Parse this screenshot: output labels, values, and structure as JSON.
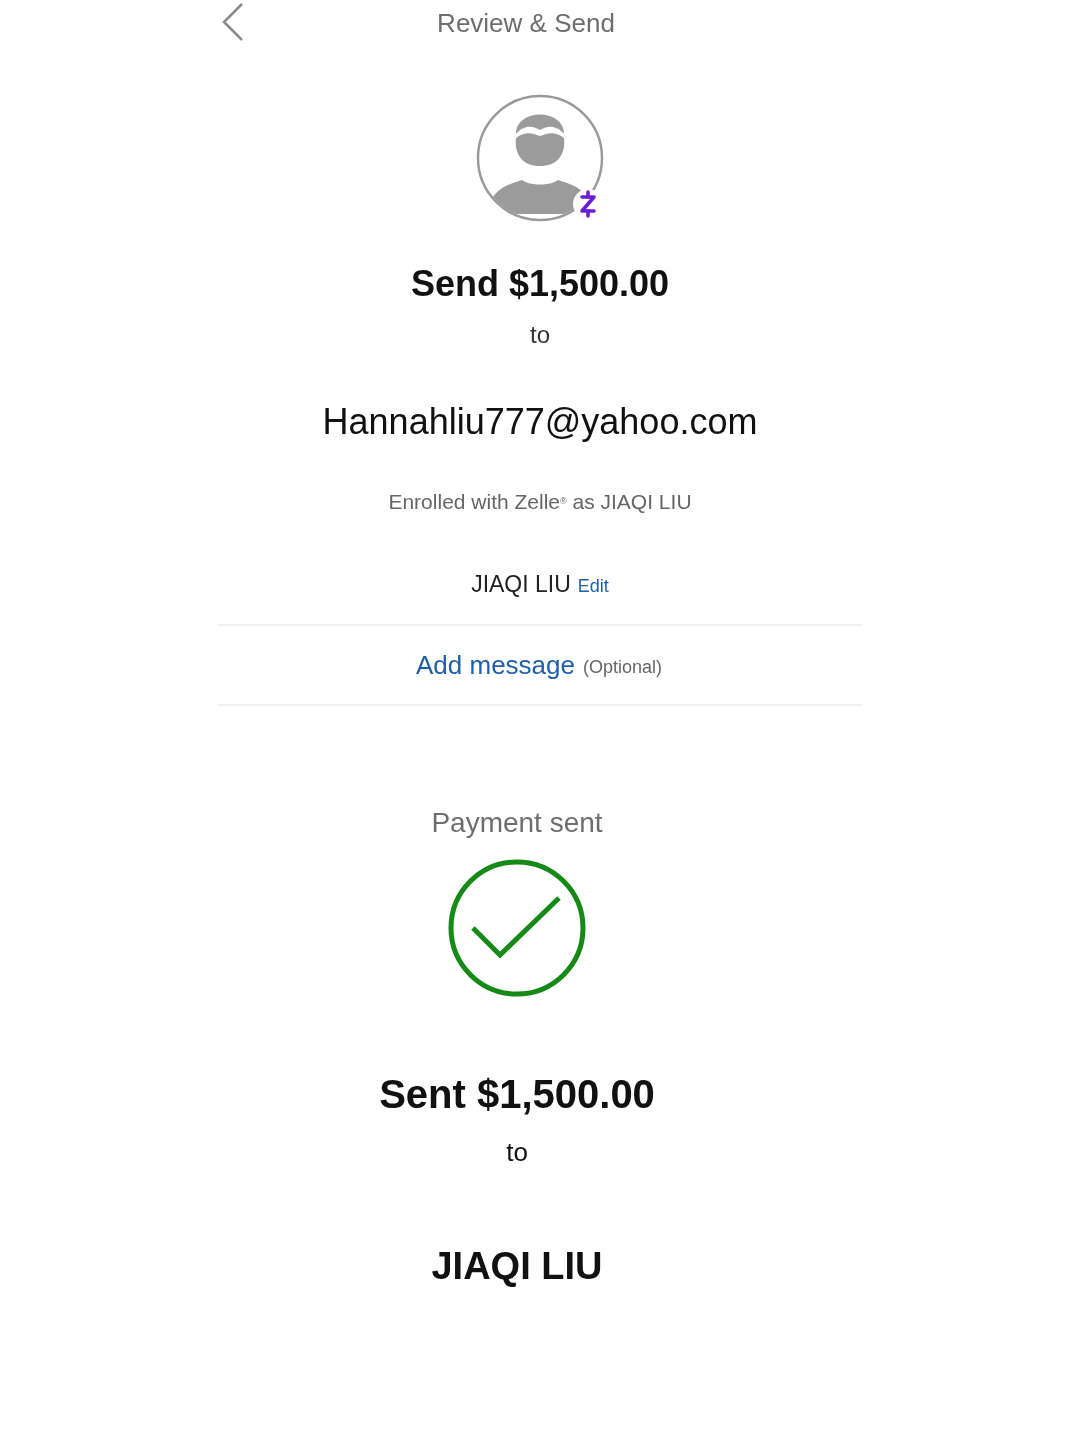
{
  "header": {
    "title": "Review & Send"
  },
  "review": {
    "amount_title": "Send $1,500.00",
    "to_label": "to",
    "recipient": "Hannahliu777@yahoo.com",
    "enrollment_note": "Enrolled with Zelle$^{®}$ as JIAQI LIU",
    "name": "JIAQI LIU",
    "edit_link": "Edit",
    "message_link": "Add message",
    "message_hint": "(Optional)"
  },
  "confirmation": {
    "status": "Payment sent",
    "amount_title": "Sent $1,500.00",
    "to_label": "to",
    "recipient_name": "JIAQI LIU"
  }
}
